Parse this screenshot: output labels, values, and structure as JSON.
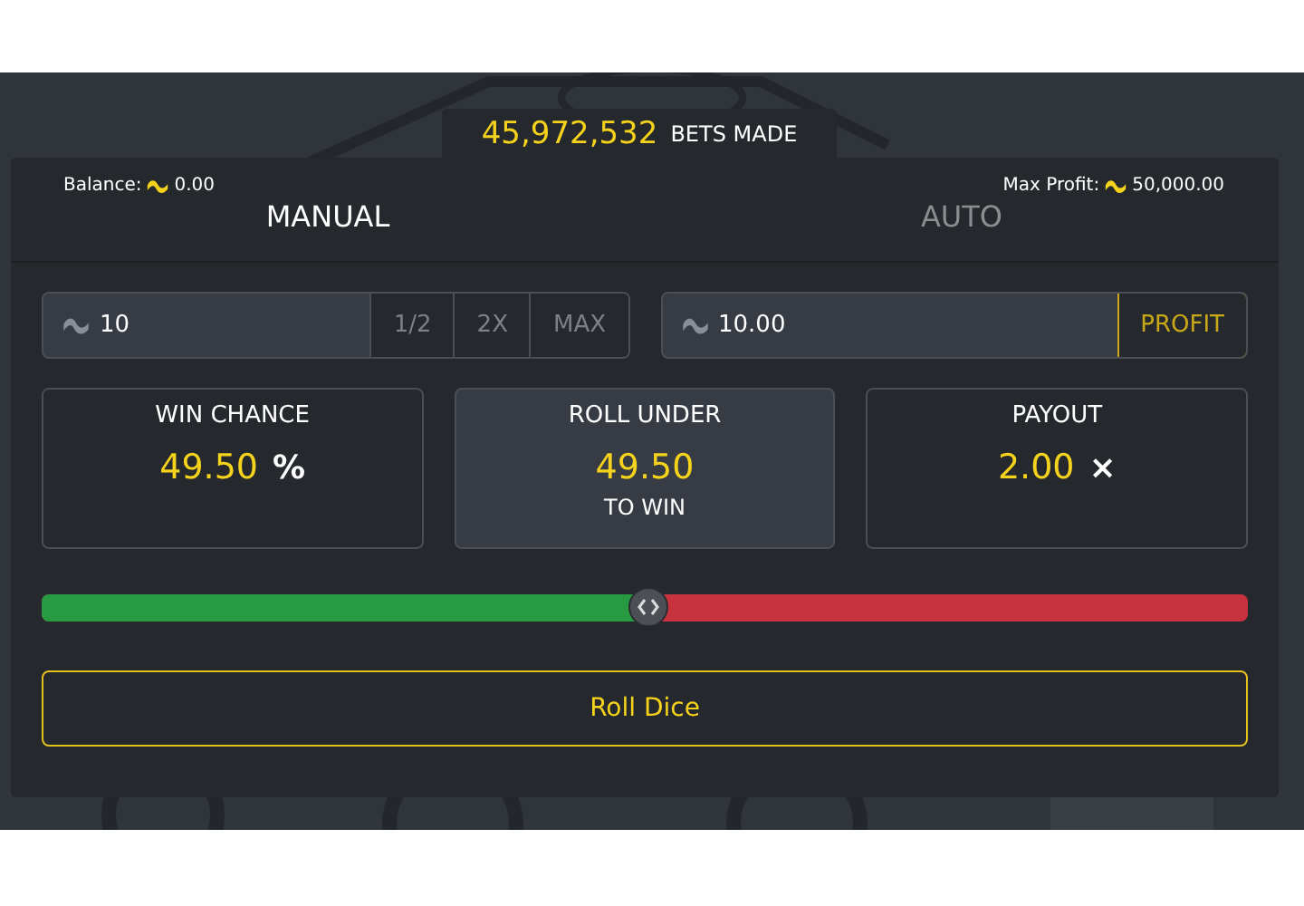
{
  "counter": {
    "value": "45,972,532",
    "label": "BETS MADE"
  },
  "balance": {
    "label": "Balance:",
    "value": "0.00"
  },
  "max_profit": {
    "label": "Max Profit:",
    "value": "50,000.00"
  },
  "tabs": [
    {
      "label": "MANUAL",
      "selected": true
    },
    {
      "label": "AUTO",
      "selected": false
    }
  ],
  "bet": {
    "value": "10",
    "buttons": [
      "1/2",
      "2X",
      "MAX"
    ]
  },
  "profit": {
    "value": "10.00",
    "button": "PROFIT"
  },
  "stats": [
    {
      "title": "WIN CHANCE",
      "value": "49.50",
      "unit": "%",
      "highlighted": false
    },
    {
      "title": "ROLL UNDER",
      "value": "49.50",
      "subtitle": "TO WIN",
      "highlighted": true
    },
    {
      "title": "PAYOUT",
      "value": "2.00",
      "unit": "×",
      "highlighted": false
    }
  ],
  "slider": {
    "level": 0.503
  },
  "roll_button": "Roll Dice"
}
